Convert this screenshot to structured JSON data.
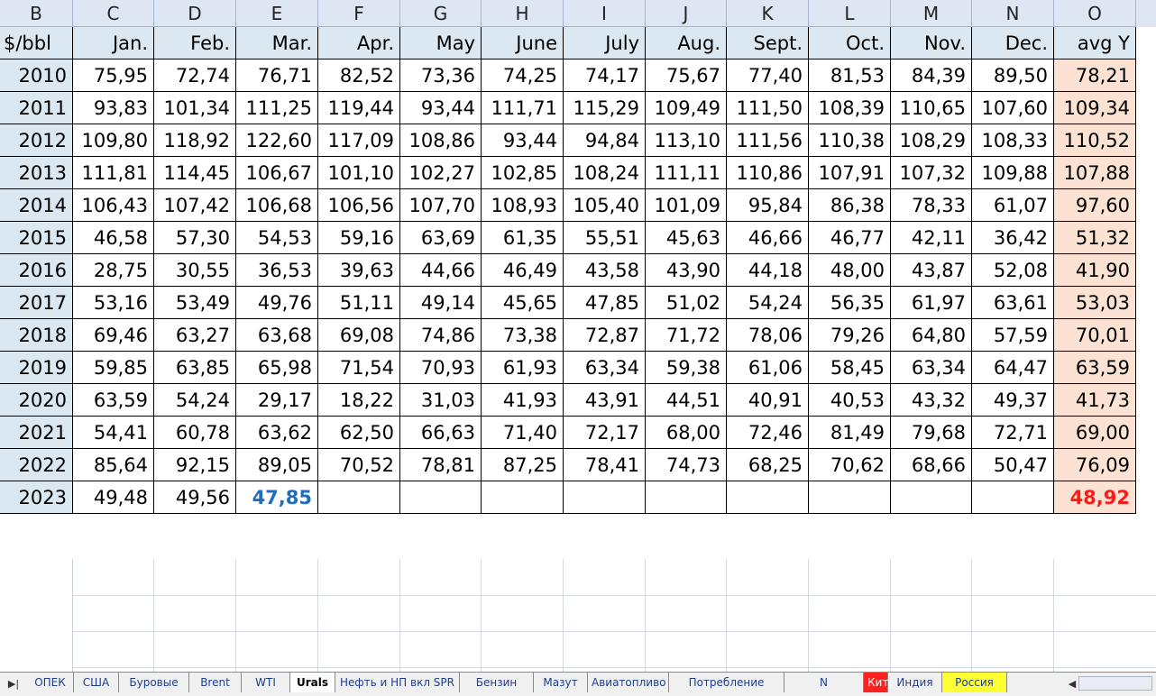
{
  "columns": [
    "B",
    "C",
    "D",
    "E",
    "F",
    "G",
    "H",
    "I",
    "J",
    "K",
    "L",
    "M",
    "N",
    "O"
  ],
  "header": [
    "$/bbl",
    "Jan.",
    "Feb.",
    "Mar.",
    "Apr.",
    "May",
    "June",
    "July",
    "Aug.",
    "Sept.",
    "Oct.",
    "Nov.",
    "Dec.",
    "avg Y"
  ],
  "rows": [
    [
      "2010",
      "75,95",
      "72,74",
      "76,71",
      "82,52",
      "73,36",
      "74,25",
      "74,17",
      "75,67",
      "77,40",
      "81,53",
      "84,39",
      "89,50",
      "78,21"
    ],
    [
      "2011",
      "93,83",
      "101,34",
      "111,25",
      "119,44",
      "93,44",
      "111,71",
      "115,29",
      "109,49",
      "111,50",
      "108,39",
      "110,65",
      "107,60",
      "109,34"
    ],
    [
      "2012",
      "109,80",
      "118,92",
      "122,60",
      "117,09",
      "108,86",
      "93,44",
      "94,84",
      "113,10",
      "111,56",
      "110,38",
      "108,29",
      "108,33",
      "110,52"
    ],
    [
      "2013",
      "111,81",
      "114,45",
      "106,67",
      "101,10",
      "102,27",
      "102,85",
      "108,24",
      "111,11",
      "110,86",
      "107,91",
      "107,32",
      "109,88",
      "107,88"
    ],
    [
      "2014",
      "106,43",
      "107,42",
      "106,68",
      "106,56",
      "107,70",
      "108,93",
      "105,40",
      "101,09",
      "95,84",
      "86,38",
      "78,33",
      "61,07",
      "97,60"
    ],
    [
      "2015",
      "46,58",
      "57,30",
      "54,53",
      "59,16",
      "63,69",
      "61,35",
      "55,51",
      "45,63",
      "46,66",
      "46,77",
      "42,11",
      "36,42",
      "51,32"
    ],
    [
      "2016",
      "28,75",
      "30,55",
      "36,53",
      "39,63",
      "44,66",
      "46,49",
      "43,58",
      "43,90",
      "44,18",
      "48,00",
      "43,87",
      "52,08",
      "41,90"
    ],
    [
      "2017",
      "53,16",
      "53,49",
      "49,76",
      "51,11",
      "49,14",
      "45,65",
      "47,85",
      "51,02",
      "54,24",
      "56,35",
      "61,97",
      "63,61",
      "53,03"
    ],
    [
      "2018",
      "69,46",
      "63,27",
      "63,68",
      "69,08",
      "74,86",
      "73,38",
      "72,87",
      "71,72",
      "78,06",
      "79,26",
      "64,80",
      "57,59",
      "70,01"
    ],
    [
      "2019",
      "59,85",
      "63,85",
      "65,98",
      "71,54",
      "70,93",
      "61,93",
      "63,34",
      "59,38",
      "61,06",
      "58,45",
      "63,34",
      "64,47",
      "63,59"
    ],
    [
      "2020",
      "63,59",
      "54,24",
      "29,17",
      "18,22",
      "31,03",
      "41,93",
      "43,91",
      "44,51",
      "40,91",
      "40,53",
      "43,32",
      "49,37",
      "41,73"
    ],
    [
      "2021",
      "54,41",
      "60,78",
      "63,62",
      "62,50",
      "66,63",
      "71,40",
      "72,17",
      "68,00",
      "72,46",
      "81,49",
      "79,68",
      "72,71",
      "69,00"
    ],
    [
      "2022",
      "85,64",
      "92,15",
      "89,05",
      "70,52",
      "78,81",
      "87,25",
      "78,41",
      "74,73",
      "68,25",
      "70,62",
      "68,66",
      "50,47",
      "76,09"
    ],
    [
      "2023",
      "49,48",
      "49,56",
      "47,85",
      "",
      "",
      "",
      "",
      "",
      "",
      "",
      "",
      "",
      "48,92"
    ]
  ],
  "highlights": {
    "blue_cell": "47,85",
    "red_cell": "48,92",
    "blue_color": "#1f6dbb",
    "red_color": "#ff1a1a"
  },
  "colors": {
    "header_bg": "#dbe8f1",
    "avg_bg": "#fbe2d2",
    "col_header_bg": "#dde6f2"
  },
  "tabs": [
    "ОПЕК",
    "США",
    "Буровые",
    "Brent",
    "WTI",
    "Urals",
    "Нефть и НП вкл SPR",
    "Бензин",
    "Мазут",
    "Авиатопливо",
    "Потребление",
    "N",
    "Китай",
    "Индия",
    "Россия"
  ],
  "active_tab": "Urals",
  "nav_icons": [
    "last-sheet-icon",
    "scroll-left-icon"
  ]
}
